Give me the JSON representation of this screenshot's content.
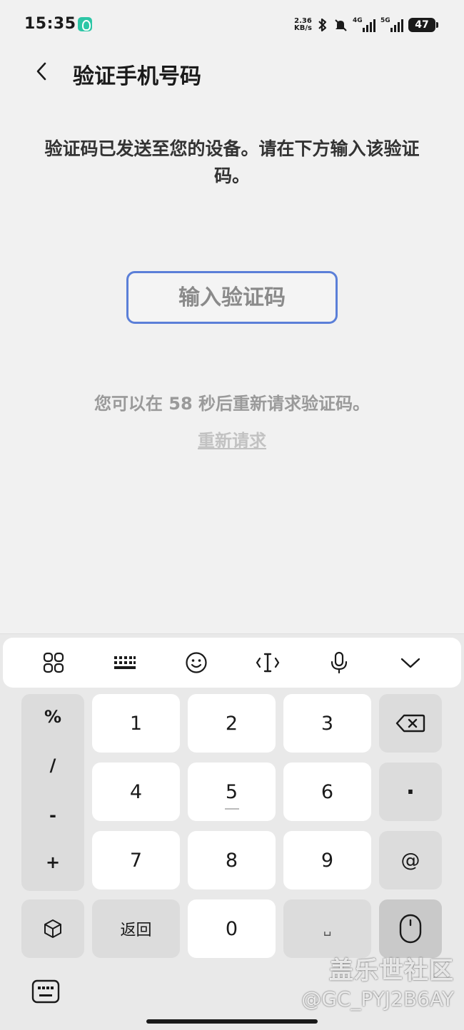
{
  "status_bar": {
    "time": "15:35",
    "net_speed_value": "2.36",
    "net_speed_unit": "KB/s",
    "sig1_label": "4G",
    "sig2_label": "5G",
    "battery": "47"
  },
  "header": {
    "title": "验证手机号码"
  },
  "main": {
    "description": "验证码已发送至您的设备。请在下方输入该验证码。",
    "code_placeholder": "输入验证码",
    "countdown": "您可以在 58 秒后重新请求验证码。",
    "resend_label": "重新请求"
  },
  "keyboard": {
    "symbols": [
      "%",
      "/",
      "-",
      "+"
    ],
    "digits": [
      "1",
      "2",
      "3",
      "4",
      "5",
      "6",
      "7",
      "8",
      "9",
      "0"
    ],
    "dot": "·",
    "at": "@",
    "back_label": "返回",
    "space": "␣"
  },
  "watermark": {
    "line1": "盖乐世社区",
    "line2": "@GC_PYJ2B6AY"
  },
  "colors": {
    "accent": "#5b7fd8",
    "background": "#f1f1f1",
    "muted_text": "#9a9a9a"
  },
  "icons": [
    "back-arrow-icon",
    "apps-grid-icon",
    "keyboard-layout-icon",
    "emoji-icon",
    "cursor-icon",
    "microphone-icon",
    "collapse-chevron-icon",
    "backspace-icon",
    "cube-icon",
    "mouse-icon",
    "keyboard-icon"
  ]
}
